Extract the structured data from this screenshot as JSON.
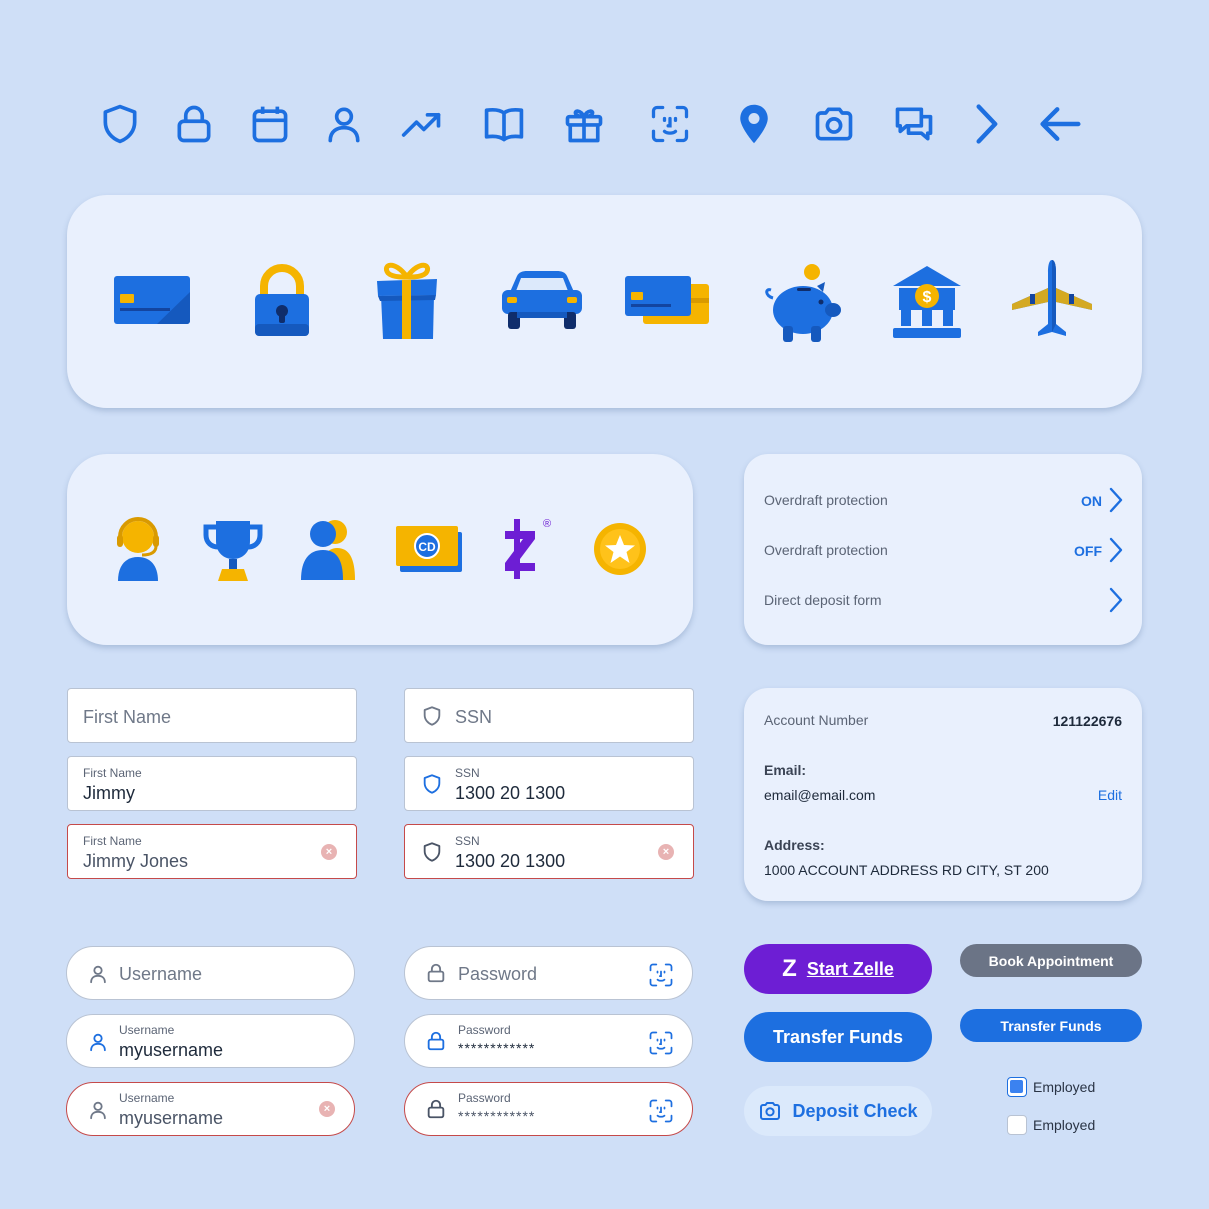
{
  "colors": {
    "background": "#cfdff7",
    "primary": "#1d6fe0",
    "zelle": "#6d1ed4",
    "gray_button": "#6b7486",
    "error": "#c54a4a",
    "accent_yellow": "#f5b400"
  },
  "line_icons": [
    "shield-icon",
    "lock-icon",
    "calendar-icon",
    "user-icon",
    "trending-up-icon",
    "book-icon",
    "gift-icon",
    "face-id-icon",
    "location-pin-icon",
    "camera-icon",
    "chat-bubbles-icon",
    "chevron-right-icon",
    "arrow-left-icon"
  ],
  "illustrations_row1": [
    "credit-card-icon",
    "padlock-icon",
    "gift-box-icon",
    "car-icon",
    "cards-icon",
    "piggy-bank-icon",
    "bank-icon",
    "airplane-icon"
  ],
  "illustrations_row2": [
    "support-agent-icon",
    "trophy-icon",
    "users-icon",
    "cd-bill-icon",
    "zelle-logo-icon",
    "star-coin-icon"
  ],
  "settings": {
    "rows": [
      {
        "label": "Overdraft protection",
        "status": "ON"
      },
      {
        "label": "Overdraft protection",
        "status": "OFF"
      },
      {
        "label": "Direct deposit form",
        "status": ""
      }
    ]
  },
  "account": {
    "number_label": "Account Number",
    "number": "121122676",
    "email_label": "Email:",
    "email": "email@email.com",
    "edit": "Edit",
    "address_label": "Address:",
    "address": "1000 ACCOUNT ADDRESS RD CITY, ST 200"
  },
  "fields": {
    "first_name_placeholder": "First Name",
    "first_name_label": "First Name",
    "first_name_value": "Jimmy",
    "first_name_error_value": "Jimmy Jones",
    "ssn_placeholder": "SSN",
    "ssn_label": "SSN",
    "ssn_value": "1300 20 1300",
    "username_placeholder": "Username",
    "username_label": "Username",
    "username_value": "myusername",
    "password_placeholder": "Password",
    "password_label": "Password",
    "password_value": "************",
    "clear_glyph": "×"
  },
  "buttons": {
    "zelle": "Start Zelle",
    "zelle_logo": "Z",
    "book": "Book Appointment",
    "transfer_large": "Transfer Funds",
    "transfer_small": "Transfer Funds",
    "deposit": "Deposit Check"
  },
  "checkboxes": [
    {
      "label": "Employed",
      "checked": true
    },
    {
      "label": "Employed",
      "checked": false
    }
  ],
  "badges": {
    "cd": "CD",
    "dollar": "$",
    "registered": "®"
  }
}
